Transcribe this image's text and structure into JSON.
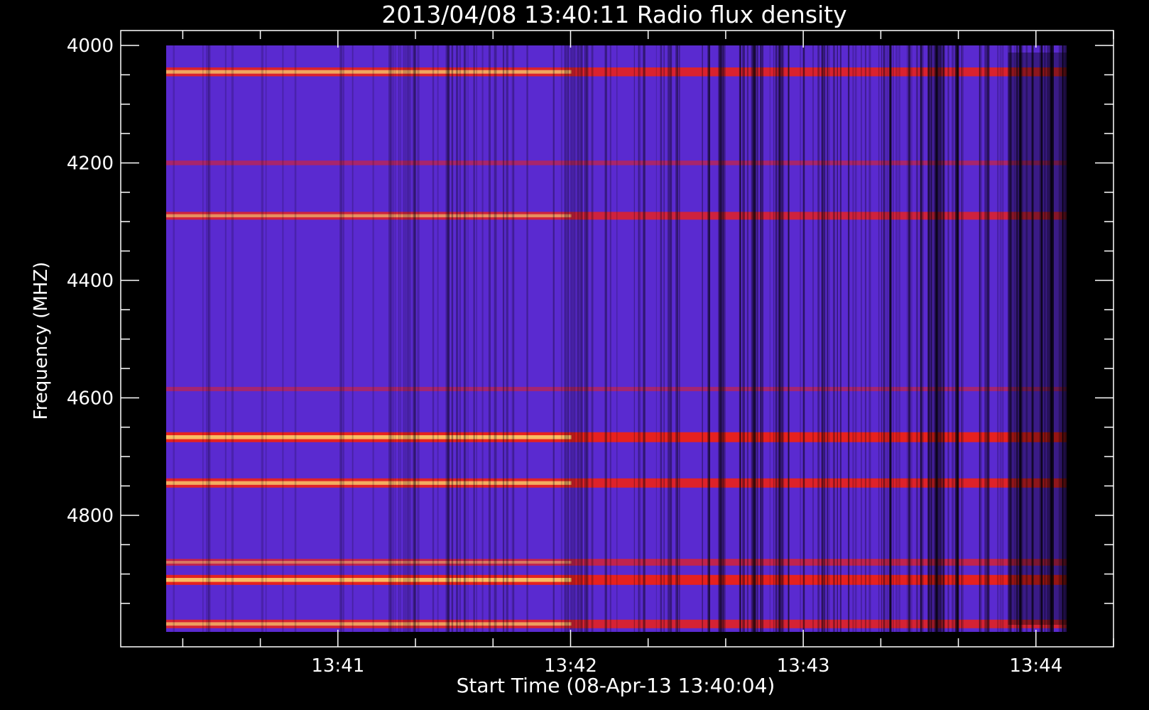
{
  "chart_data": {
    "type": "heatmap",
    "title": "2013/04/08 13:40:11 Radio flux density",
    "xlabel": "Start Time (08-Apr-13 13:40:04)",
    "ylabel": "Frequency (MHZ)",
    "x_axis": {
      "unit": "time",
      "data_range": [
        "13:40:11",
        "13:44:11"
      ],
      "axis_range": [
        "13:40:04",
        "13:44:20"
      ],
      "major_ticks": [
        "13:41",
        "13:42",
        "13:43",
        "13:44"
      ],
      "minor_tick_interval_seconds": 20
    },
    "y_axis": {
      "unit": "MHz",
      "range": [
        4000,
        5000
      ],
      "inverted": true,
      "major_ticks": [
        4000,
        4200,
        4400,
        4600,
        4800
      ],
      "minor_tick_interval": 50
    },
    "colormap": {
      "background": "#5a2ad0",
      "low": "#000000",
      "mid": "#ff2000",
      "high": "#ffff80"
    },
    "bright_bands_mhz": [
      {
        "center": 4045,
        "intensity": 0.85
      },
      {
        "center": 4200,
        "intensity": 0.25
      },
      {
        "center": 4290,
        "intensity": 0.7
      },
      {
        "center": 4585,
        "intensity": 0.2
      },
      {
        "center": 4667,
        "intensity": 1.0
      },
      {
        "center": 4745,
        "intensity": 0.9
      },
      {
        "center": 4880,
        "intensity": 0.55
      },
      {
        "center": 4910,
        "intensity": 1.0
      },
      {
        "center": 4985,
        "intensity": 0.8
      }
    ]
  }
}
